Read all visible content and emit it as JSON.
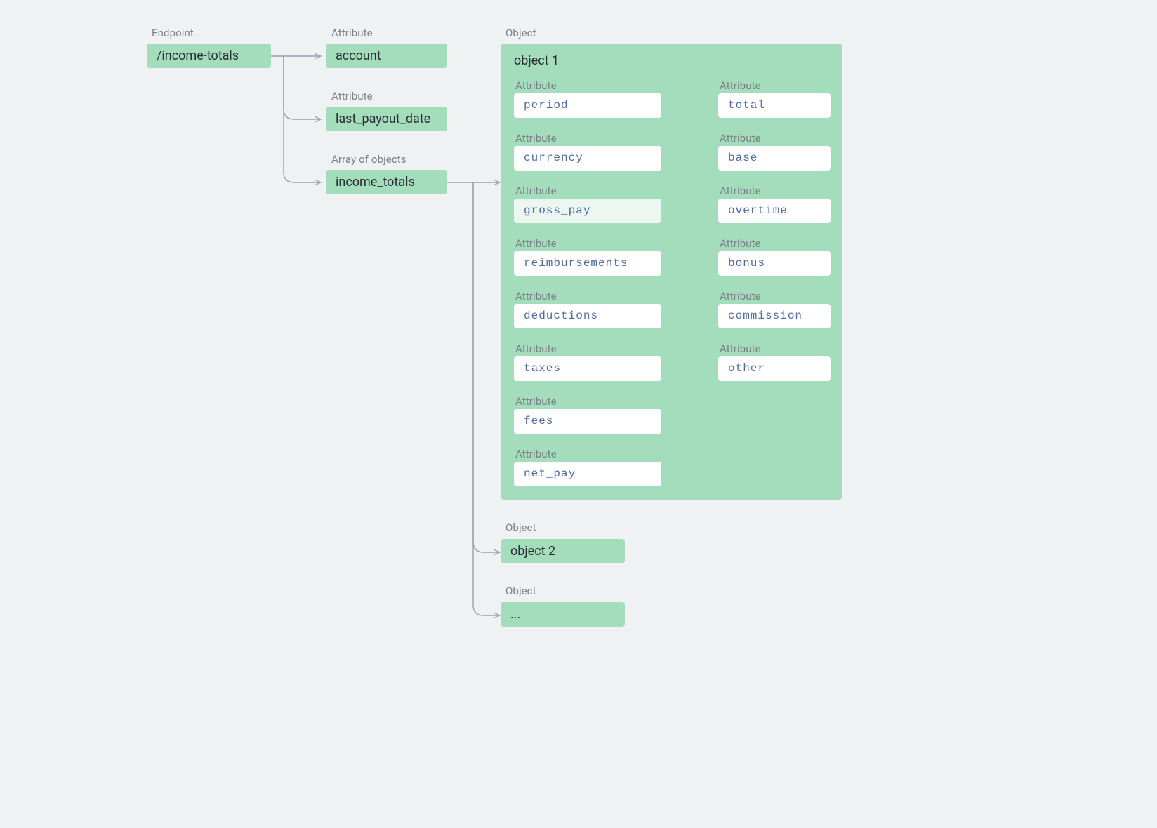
{
  "endpoint": {
    "label": "Endpoint",
    "value": "/income-totals"
  },
  "top_attrs": [
    {
      "label": "Attribute",
      "value": "account"
    },
    {
      "label": "Attribute",
      "value": "last_payout_date"
    },
    {
      "label": "Array of objects",
      "value": "income_totals"
    }
  ],
  "object1": {
    "label": "Object",
    "title": "object 1",
    "left_attrs": [
      {
        "label": "Attribute",
        "value": "period"
      },
      {
        "label": "Attribute",
        "value": "currency"
      },
      {
        "label": "Attribute",
        "value": "gross_pay",
        "pale": true
      },
      {
        "label": "Attribute",
        "value": "reimbursements"
      },
      {
        "label": "Attribute",
        "value": "deductions"
      },
      {
        "label": "Attribute",
        "value": "taxes"
      },
      {
        "label": "Attribute",
        "value": "fees"
      },
      {
        "label": "Attribute",
        "value": "net_pay"
      }
    ],
    "right_attrs": [
      {
        "label": "Attribute",
        "value": "total"
      },
      {
        "label": "Attribute",
        "value": "base"
      },
      {
        "label": "Attribute",
        "value": "overtime"
      },
      {
        "label": "Attribute",
        "value": "bonus"
      },
      {
        "label": "Attribute",
        "value": "commission"
      },
      {
        "label": "Attribute",
        "value": "other"
      }
    ]
  },
  "tail_objects": [
    {
      "label": "Object",
      "value": "object 2"
    },
    {
      "label": "Object",
      "value": "..."
    }
  ]
}
